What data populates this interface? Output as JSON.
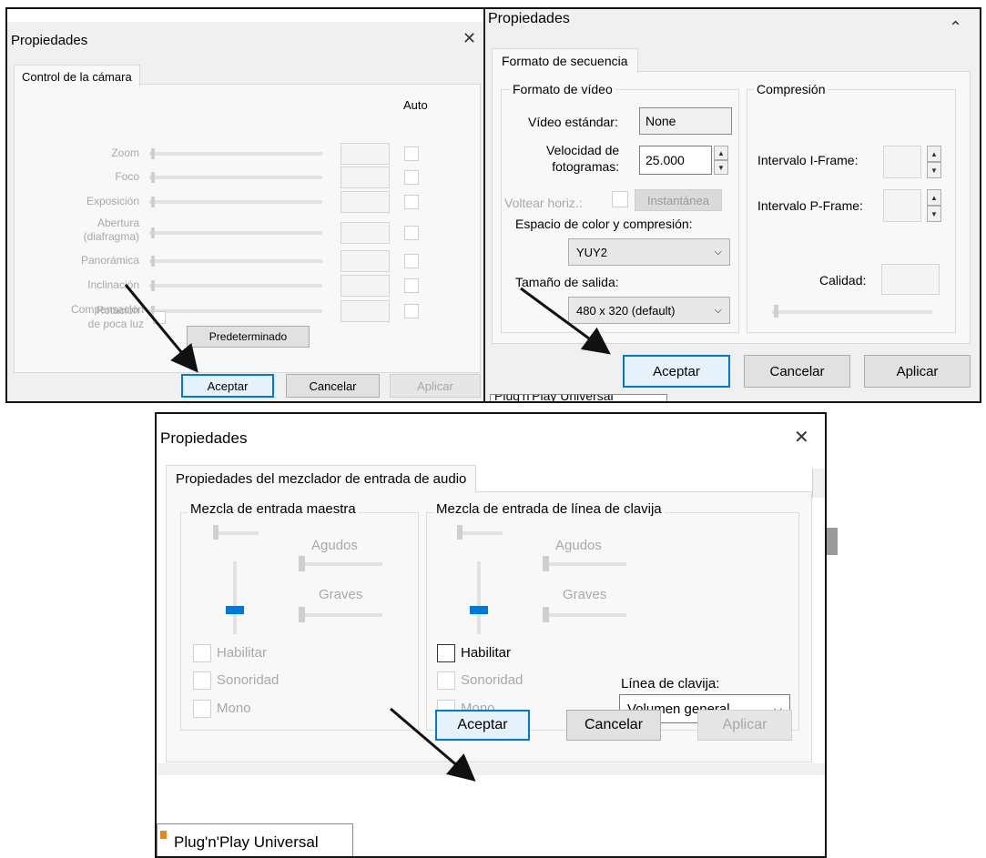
{
  "win1": {
    "title": "Propiedades",
    "close_glyph": "✕",
    "tab": "Control de la cámara",
    "auto_header": "Auto",
    "rows": [
      {
        "label": "Zoom"
      },
      {
        "label": "Foco"
      },
      {
        "label": "Exposición"
      },
      {
        "label": "Abertura\n(diafragma)"
      },
      {
        "label": "Panorámica"
      },
      {
        "label": "Inclinación"
      },
      {
        "label": "Rotación"
      }
    ],
    "low_light_label": "Compensación\nde poca luz",
    "default_button": "Predeterminado",
    "ok": "Aceptar",
    "cancel": "Cancelar",
    "apply": "Aplicar"
  },
  "win2": {
    "title": "Propiedades",
    "chevron_glyph": "⌃",
    "tab": "Formato de secuencia",
    "video_group": "Formato de vídeo",
    "standard_label": "Vídeo estándar:",
    "standard_value": "None",
    "framerate_label": "Velocidad de\nfotogramas:",
    "framerate_value": "25.000",
    "flip_label": "Voltear horiz.:",
    "snapshot_button": "Instantánea",
    "color_space_label": "Espacio de color y compresión:",
    "color_space_value": "YUY2",
    "output_size_label": "Tamaño de salida:",
    "output_size_value": "480 x 320  (default)",
    "compression_group": "Compresión",
    "iframe_label": "Intervalo I-Frame:",
    "pframe_label": "Intervalo P-Frame:",
    "quality_label": "Calidad:",
    "ok": "Aceptar",
    "cancel": "Cancelar",
    "apply": "Aplicar",
    "peek_text": "Plug'n'Play Universal"
  },
  "win3": {
    "title": "Propiedades",
    "close_glyph": "✕",
    "tab": "Propiedades del mezclador de entrada de audio",
    "master_group": "Mezcla de entrada maestra",
    "line_group": "Mezcla de entrada de línea de clavija",
    "treble_label": "Agudos",
    "bass_label": "Graves",
    "enable_label": "Habilitar",
    "loudness_label": "Sonoridad",
    "mono_label": "Mono",
    "line_label": "Línea de clavija:",
    "line_value": "Volumen general",
    "ok": "Aceptar",
    "cancel": "Cancelar",
    "apply": "Aplicar",
    "taskbar_item": "Plug'n'Play Universal"
  },
  "colors": {
    "accent": "#0078d7",
    "disabled_text": "#a8a8a8",
    "dialog_bg": "#f0f0f0"
  }
}
